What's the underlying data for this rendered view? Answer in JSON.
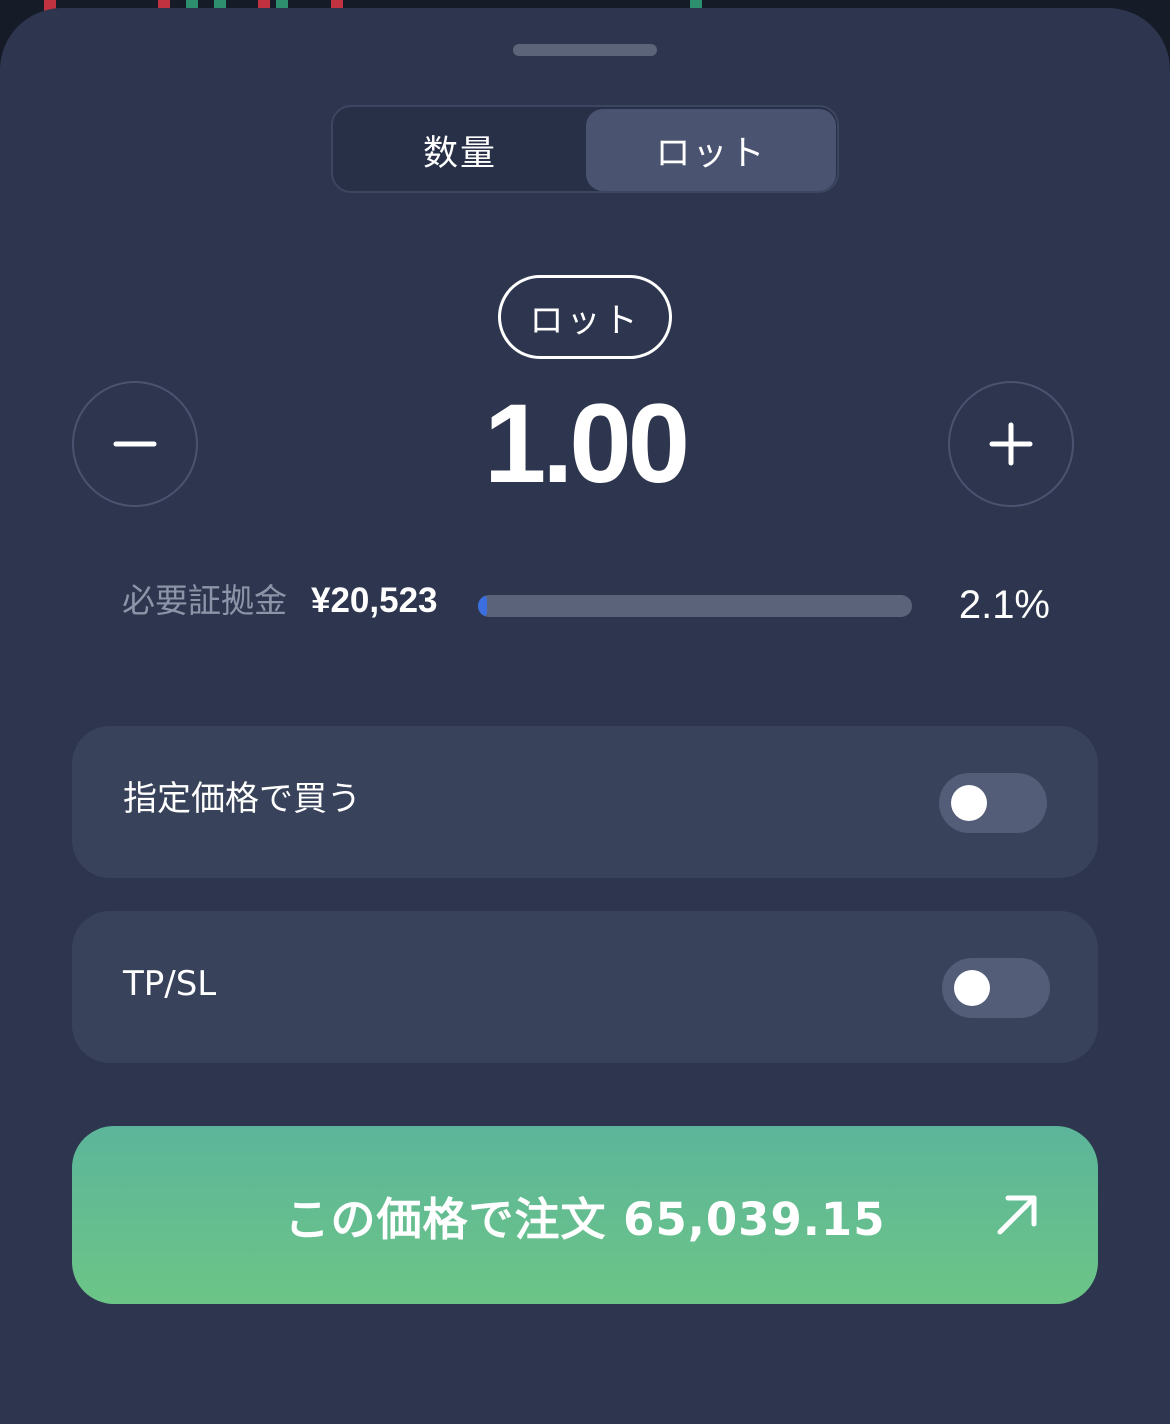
{
  "unit_toggle": {
    "options": [
      {
        "label": "数量",
        "selected": false
      },
      {
        "label": "ロット",
        "selected": true
      }
    ]
  },
  "amount": {
    "unit_label": "ロット",
    "value": "1.00",
    "decrement_icon": "minus-icon",
    "increment_icon": "plus-icon"
  },
  "margin": {
    "label": "必要証拠金",
    "value": "¥20,523",
    "percent_text": "2.1%",
    "percent": 2.1
  },
  "options": {
    "limit": {
      "label": "指定価格で買う",
      "enabled": false
    },
    "tpsl": {
      "label": "TP/SL",
      "enabled": false
    }
  },
  "order_button": {
    "label": "この価格で注文 65,039.15",
    "icon": "arrow-up-right-icon"
  },
  "colors": {
    "sheet_bg": "#2d364e",
    "card_bg": "#38425a",
    "accent_green": "#6cc586",
    "progress_fill": "#3b6fe0",
    "candle_red": "#c0323f",
    "candle_green": "#2e8f6f"
  }
}
